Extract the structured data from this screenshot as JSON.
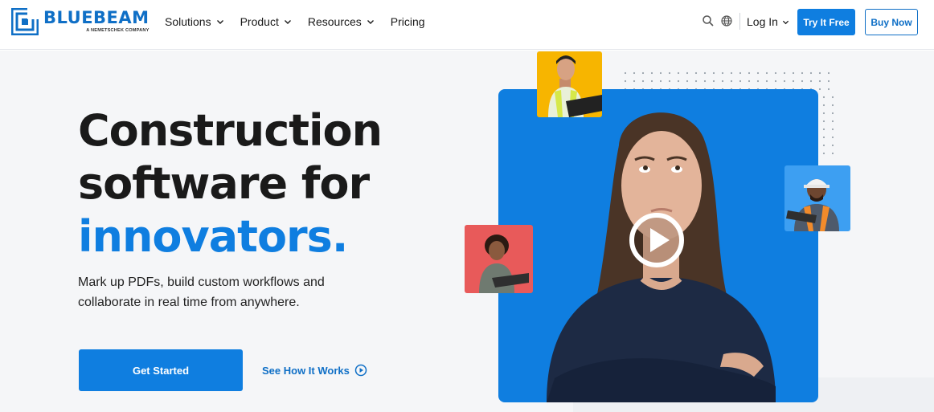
{
  "brand": {
    "name": "BLUEBEAM",
    "tagline": "A NEMETSCHEK COMPANY",
    "color": "#0f6fc6"
  },
  "nav": {
    "items": [
      {
        "label": "Solutions",
        "has_dropdown": true
      },
      {
        "label": "Product",
        "has_dropdown": true
      },
      {
        "label": "Resources",
        "has_dropdown": true
      },
      {
        "label": "Pricing",
        "has_dropdown": false
      }
    ],
    "login_label": "Log In",
    "try_label": "Try It Free",
    "buy_label": "Buy Now"
  },
  "hero": {
    "headline_line1": "Construction",
    "headline_line2": "software for",
    "headline_accent": "innovators.",
    "subtext": "Mark up PDFs, build custom workflows and collaborate in real time from anywhere.",
    "primary_cta": "Get Started",
    "secondary_cta": "See How It Works",
    "accent_color": "#0f7ee0"
  },
  "icons": {
    "search": "search-icon",
    "globe": "globe-icon",
    "play": "play-icon"
  }
}
